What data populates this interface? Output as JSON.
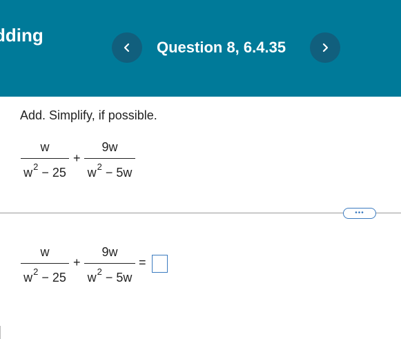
{
  "header": {
    "partial_title": "dding",
    "question_title": "Question 8, 6.4.35",
    "prev_icon": "chevron-left-icon",
    "next_icon": "chevron-right-icon"
  },
  "instruction": "Add.  Simplify, if possible.",
  "problem": {
    "frac1_num": "w",
    "frac1_den_base": "w",
    "frac1_den_exp": "2",
    "frac1_den_rest": " − 25",
    "operator": "+",
    "frac2_num": "9w",
    "frac2_den_base": "w",
    "frac2_den_exp": "2",
    "frac2_den_rest": " − 5w"
  },
  "answer_row": {
    "frac1_num": "w",
    "frac1_den_base": "w",
    "frac1_den_exp": "2",
    "frac1_den_rest": " − 25",
    "operator": "+",
    "frac2_num": "9w",
    "frac2_den_base": "w",
    "frac2_den_exp": "2",
    "frac2_den_rest": " − 5w",
    "equals": "=",
    "answer_value": ""
  },
  "more_button_label": "•••",
  "colors": {
    "header_bg": "#007a99",
    "nav_button_bg": "#115f7d",
    "accent_blue": "#3a7abf"
  }
}
